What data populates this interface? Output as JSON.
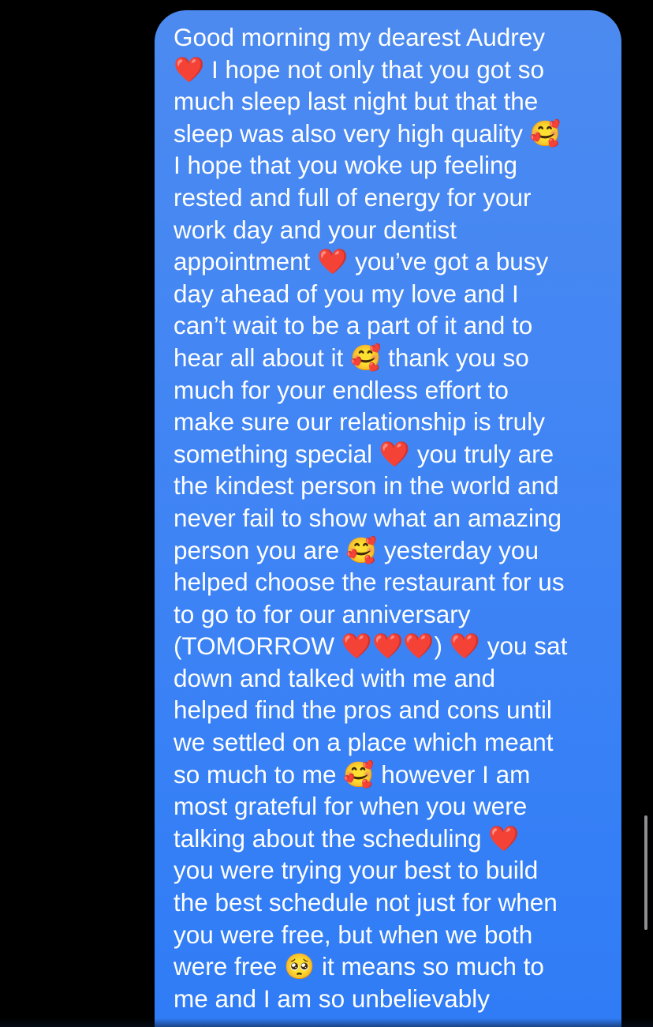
{
  "message": {
    "direction": "outgoing",
    "bubble_color": "#3f84f5",
    "text_color": "#ffffff",
    "lines": [
      "Good morning my dearest Audrey",
      "❤️ I hope not only that you got so",
      "much sleep last night but that the",
      "sleep was also very high quality 🥰",
      "I hope that you woke up feeling",
      "rested and full of energy for your",
      "work day and your dentist",
      "appointment ❤️ you’ve got a busy",
      "day ahead of you my love and I",
      "can’t wait to be a part of it and to",
      "hear all about it 🥰 thank you so",
      "much for your endless effort to",
      "make sure our relationship is truly",
      "something special ❤️ you truly are",
      "the kindest person in the world and",
      "never fail to show what an amazing",
      "person you are 🥰 yesterday you",
      "helped choose the restaurant for us",
      "to go to for our anniversary",
      "(TOMORROW ❤️❤️❤️) ❤️ you sat",
      "down and talked with me and",
      "helped find the pros and cons until",
      "we settled on a place which meant",
      "so much to me 🥰 however I am",
      "most grateful for when you were",
      "talking about the scheduling ❤️",
      "you were trying your best to build",
      "the best schedule not just for when",
      "you were free, but when we both",
      "were free 🥺 it means so much to",
      "me and I am so unbelievably"
    ]
  },
  "icons": {
    "heart": "red-heart-emoji",
    "smiling_hearts": "smiling-face-with-hearts-emoji",
    "pleading": "pleading-face-emoji"
  }
}
